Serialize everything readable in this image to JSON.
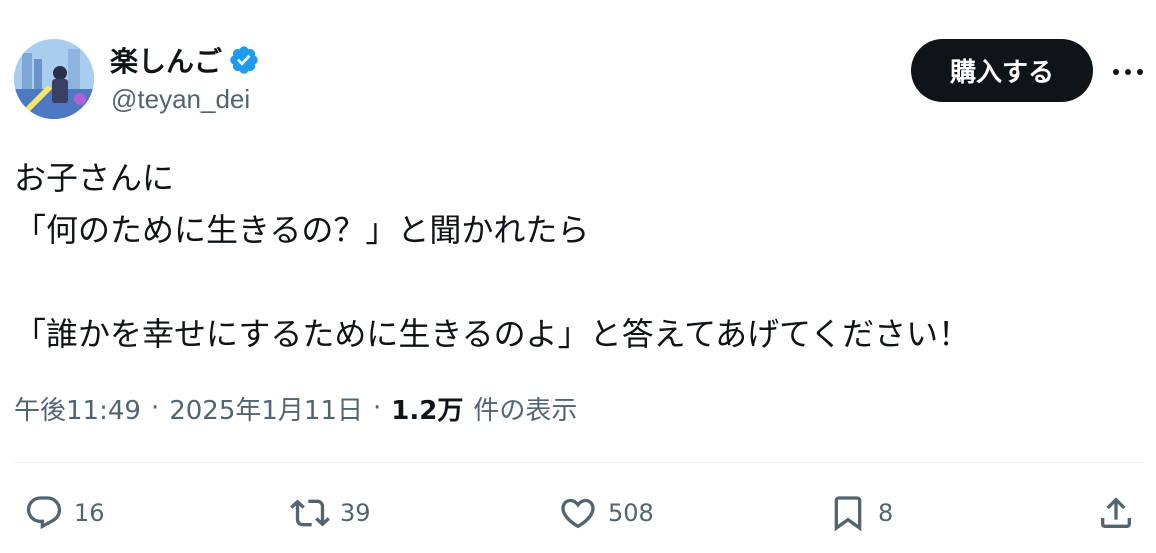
{
  "author": {
    "display_name": "楽しんご",
    "handle": "@teyan_dei",
    "verified_icon": "verified-badge-icon",
    "avatar_icon": "avatar-image"
  },
  "header": {
    "buy_label": "購入する",
    "more_icon": "more-horizontal-icon"
  },
  "tweet": {
    "text": "お子さんに\n「何のために生きるの？」と聞かれたら\n\n「誰かを幸せにするために生きるのよ」と答えてあげてください！"
  },
  "meta": {
    "time": "午後11:49",
    "separator": "·",
    "date": "2025年1月11日",
    "views_count": "1.2万",
    "views_label": "件の表示"
  },
  "actions": {
    "reply": {
      "icon": "reply-icon",
      "count": "16"
    },
    "repost": {
      "icon": "repost-icon",
      "count": "39"
    },
    "like": {
      "icon": "heart-icon",
      "count": "508"
    },
    "bookmark": {
      "icon": "bookmark-icon",
      "count": "8"
    },
    "share": {
      "icon": "share-icon"
    }
  },
  "colors": {
    "text_primary": "#0f1419",
    "text_secondary": "#536471",
    "verified_blue": "#1d9bf0",
    "button_bg": "#0f1419",
    "divider": "#eff3f4"
  }
}
